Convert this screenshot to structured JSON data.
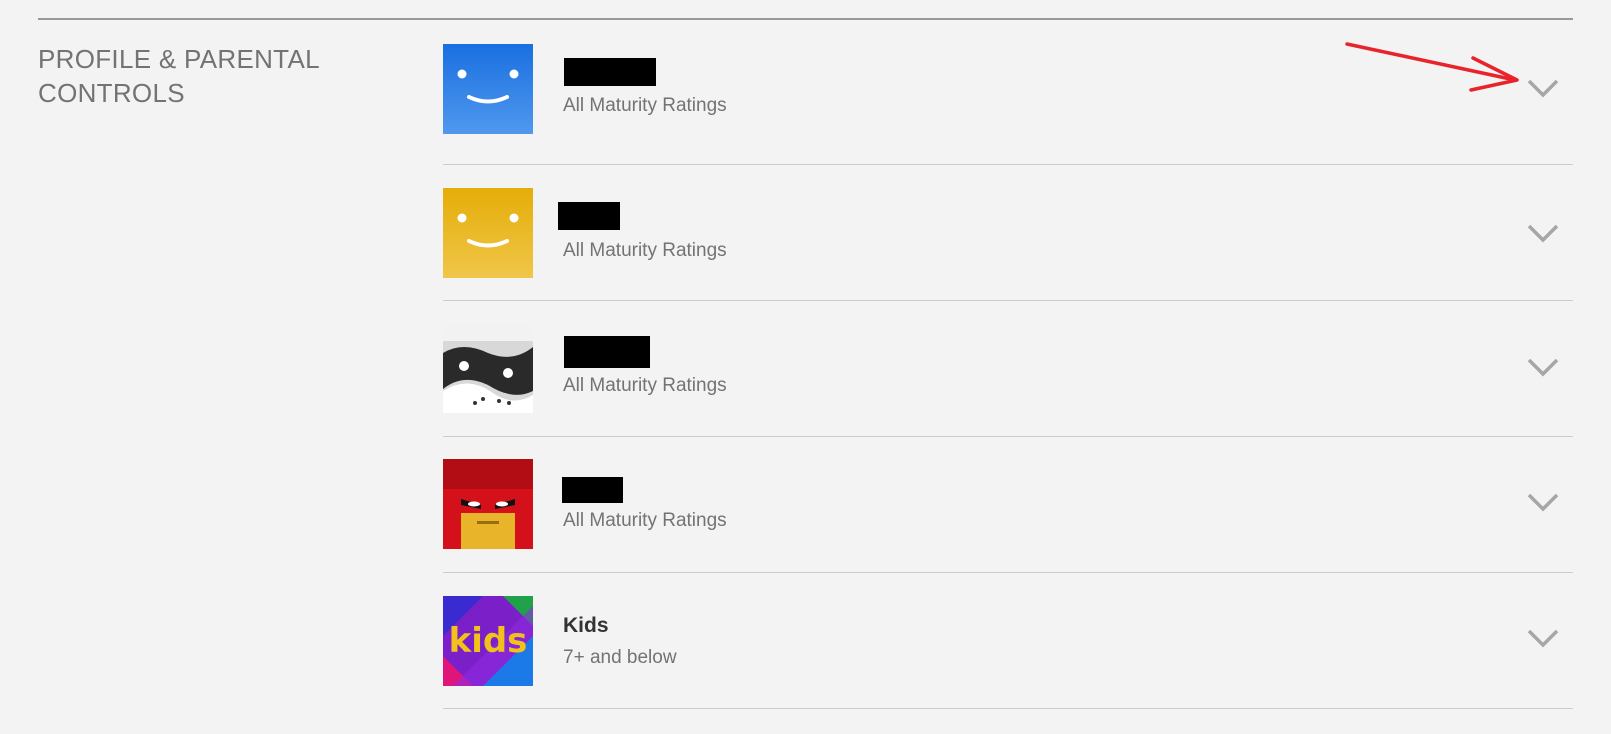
{
  "section": {
    "title_line1": "PROFILE & PARENTAL",
    "title_line2": "CONTROLS"
  },
  "profiles": [
    {
      "name": "",
      "rating": "All Maturity Ratings",
      "avatar": "blue-smiley",
      "name_redacted": true
    },
    {
      "name": "",
      "rating": "All Maturity Ratings",
      "avatar": "yellow-smiley",
      "name_redacted": true
    },
    {
      "name": "",
      "rating": "All Maturity Ratings",
      "avatar": "black-white-panda",
      "name_redacted": true
    },
    {
      "name": "",
      "rating": "All Maturity Ratings",
      "avatar": "red-hero",
      "name_redacted": true
    },
    {
      "name": "Kids",
      "rating": "7+ and below",
      "avatar": "kids",
      "name_redacted": false
    }
  ],
  "kids_logo_text": "kids",
  "colors": {
    "background": "#f3f3f3",
    "annotation_arrow": "#e8232b",
    "chevron": "#a6a6a6"
  }
}
